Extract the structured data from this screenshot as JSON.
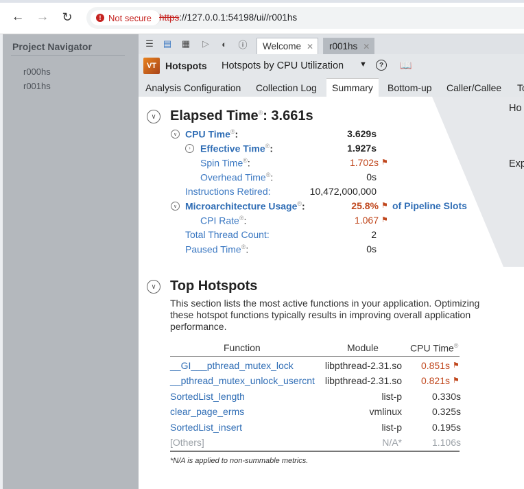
{
  "browser": {
    "security_label": "Not secure",
    "url_scheme": "https",
    "url_rest": "://127.0.0.1:54198/ui//r001hs",
    "icons": [
      "back-arrow-icon",
      "forward-arrow-icon",
      "reload-icon",
      "warning-icon"
    ]
  },
  "navigator": {
    "title": "Project Navigator",
    "items": [
      "r000hs",
      "r001hs"
    ]
  },
  "toolbar": {
    "icons": [
      "menu-icon",
      "project-icon",
      "new-analysis-icon",
      "run-icon",
      "compare-icon",
      "help-icon"
    ],
    "tabs": [
      {
        "label": "Welcome",
        "close": "✕"
      },
      {
        "label": "r001hs",
        "close": "✕"
      }
    ]
  },
  "analysis": {
    "logo": "VT",
    "title": "Hotspots",
    "viewpoint": "Hotspots by CPU Utilization",
    "caret": "▼",
    "help": "?"
  },
  "subtabs": [
    "Analysis Configuration",
    "Collection Log",
    "Summary",
    "Bottom-up",
    "Caller/Callee",
    "To"
  ],
  "side_panel": {
    "label1": "Ho",
    "label2": "Exp"
  },
  "elapsed": {
    "title": "Elapsed Time",
    "sup": "®",
    "value": ": 3.661s",
    "metrics": [
      {
        "label": "CPU Time",
        "sup": "®",
        "suffix": ":",
        "value": "3.629s",
        "style": "bold"
      },
      {
        "label": "Effective Time",
        "sup": "®",
        "suffix": ":",
        "value": "1.927s",
        "style": "bold"
      },
      {
        "label": "Spin Time",
        "sup": "®",
        "suffix": ":",
        "value": "1.702s",
        "style": "red"
      },
      {
        "label": "Overhead Time",
        "sup": "®",
        "suffix": ":",
        "value": "0s",
        "style": "normal"
      },
      {
        "label": "Instructions Retired:",
        "value": "10,472,000,000",
        "style": "normal"
      },
      {
        "label": "Microarchitecture Usage",
        "sup": "®",
        "suffix": ":",
        "value": "25.8%",
        "style": "red-bold",
        "tail": "of Pipeline Slots"
      },
      {
        "label": "CPI Rate",
        "sup": "®",
        "suffix": ":",
        "value": "1.067",
        "style": "red"
      },
      {
        "label": "Total Thread Count:",
        "value": "2",
        "style": "normal"
      },
      {
        "label": "Paused Time",
        "sup": "®",
        "suffix": ":",
        "value": "0s",
        "style": "normal"
      }
    ]
  },
  "hotspots": {
    "title": "Top Hotspots",
    "description": "This section lists the most active functions in your application. Optimizing these hotspot functions typically results in improving overall application performance.",
    "columns": {
      "function": "Function",
      "module": "Module",
      "cpu": "CPU Time",
      "cpu_sup": "®"
    },
    "rows": [
      {
        "function": "__GI___pthread_mutex_lock",
        "module": "libpthread-2.31.so",
        "cpu": "0.851s",
        "flag": true
      },
      {
        "function": "__pthread_mutex_unlock_usercnt",
        "module": "libpthread-2.31.so",
        "cpu": "0.821s",
        "flag": true
      },
      {
        "function": "SortedList_length",
        "module": "list-p",
        "cpu": "0.330s",
        "flag": false
      },
      {
        "function": "clear_page_erms",
        "module": "vmlinux",
        "cpu": "0.325s",
        "flag": false
      },
      {
        "function": "SortedList_insert",
        "module": "list-p",
        "cpu": "0.195s",
        "flag": false
      },
      {
        "function": "[Others]",
        "module": "N/A*",
        "cpu": "1.106s",
        "flag": false,
        "other": true
      }
    ],
    "footnote": "*N/A is applied to non-summable metrics."
  }
}
